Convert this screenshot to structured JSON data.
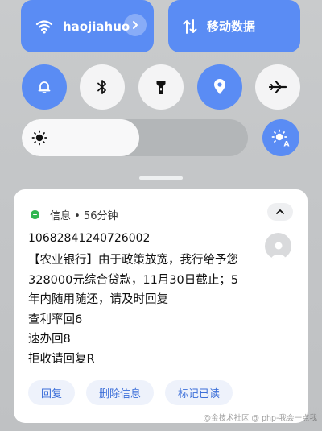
{
  "quick_tiles": {
    "wifi": {
      "label": "haojiahuo",
      "icon": "wifi-icon"
    },
    "mobile_data": {
      "label": "移动数据",
      "icon": "arrows-updown-icon"
    }
  },
  "toggles": [
    {
      "name": "bell",
      "icon": "bell-icon",
      "on": true
    },
    {
      "name": "bluetooth",
      "icon": "bluetooth-icon",
      "on": false
    },
    {
      "name": "flashlight",
      "icon": "flashlight-icon",
      "on": false
    },
    {
      "name": "location",
      "icon": "location-pin-icon",
      "on": true
    },
    {
      "name": "airplane",
      "icon": "airplane-icon",
      "on": false
    }
  ],
  "brightness": {
    "level": 0.52,
    "auto": true
  },
  "notification": {
    "app": "信息",
    "time": "56分钟",
    "header": "信息 • 56分钟",
    "sender": "10682841240726002",
    "lines": [
      "【农业银行】由于政策放宽，我行给予您",
      "328000元综合贷款，11月30日截止；5",
      "年内随用随还，请及时回复",
      "查利率回6",
      "速办回8",
      "拒收请回复R"
    ],
    "actions": {
      "reply": "回复",
      "delete": "删除信息",
      "mark_read": "标记已读"
    }
  },
  "watermark": "@金技术社区 @ php-我会一点我",
  "colors": {
    "accent": "#5a8cf4",
    "action_text": "#3c6fd9",
    "app_green": "#2fb64f"
  }
}
